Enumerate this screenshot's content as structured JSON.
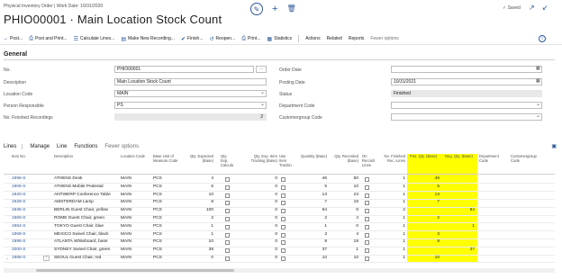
{
  "header": {
    "breadcrumb": "Physical Inventory Order | Work Date: 10/31/2020",
    "title": "PHIO00001 · Main Location Stock Count",
    "saved_label": "✓ Saved",
    "edit_icon": "pencil-icon",
    "new_icon": "plus-icon",
    "delete_icon": "trash-icon"
  },
  "actions": [
    {
      "icon": "post-icon",
      "label": "Post..."
    },
    {
      "icon": "post-print-icon",
      "label": "Post and Print..."
    },
    {
      "icon": "calculate-icon",
      "label": "Calculate Lines..."
    },
    {
      "icon": "recording-icon",
      "label": "Make New Recording..."
    },
    {
      "icon": "check-icon",
      "label": "Finish..."
    },
    {
      "icon": "reopen-icon",
      "label": "Reopen..."
    },
    {
      "icon": "print-icon",
      "label": "Print..."
    },
    {
      "icon": "statistics-icon",
      "label": "Statistics"
    }
  ],
  "action_menus": [
    "Actions",
    "Related",
    "Reports",
    "Fewer options"
  ],
  "general": {
    "section_title": "General",
    "left": [
      {
        "label": "No.",
        "value": "PHIO00001",
        "kind": "text"
      },
      {
        "label": "Description",
        "value": "Main Location Stock Count",
        "kind": "text"
      },
      {
        "label": "Location Code",
        "value": "MAIN",
        "kind": "select"
      },
      {
        "label": "Person Responsible",
        "value": "PS",
        "kind": "select"
      },
      {
        "label": "No. Finished Recordings",
        "value": "2",
        "kind": "readonly"
      }
    ],
    "right": [
      {
        "label": "Order Date",
        "value": "",
        "kind": "date"
      },
      {
        "label": "Posting Date",
        "value": "10/31/2021",
        "kind": "date"
      },
      {
        "label": "Status",
        "value": "Finished",
        "kind": "readonly"
      },
      {
        "label": "Department Code",
        "value": "",
        "kind": "select"
      },
      {
        "label": "Customergroup Code",
        "value": "",
        "kind": "select"
      }
    ]
  },
  "lines": {
    "tabs": [
      "Lines",
      "Manage",
      "Line",
      "Functions",
      "Fewer options"
    ],
    "columns": {
      "item_no": "Item No.",
      "description": "Description",
      "location": "Location Code",
      "base_uom": "Base Unit of Measure Code",
      "qty_expected": "Qty. Expected (Base)",
      "qty_exp_calculated": "Qty. Exp. Calculated",
      "qty_exp_item_tracking": "Qty. Exp. Item Tracking (Base)",
      "use_item_tracking": "Use Item Tracking",
      "quantity_base": "Quantity (Base)",
      "qty_recorded": "Qty. Recorded (Base)",
      "on_recording_lines": "On Recording Lines",
      "no_finished_rec_lines": "No. Finished Rec.-Lines",
      "pos_qty": "Pos. Qty. (Base)",
      "neg_qty": "Neg. Qty. (Base)",
      "department_code": "Department Code",
      "customergroup_code": "Customergroup Code"
    },
    "rows": [
      {
        "item": "1896-S",
        "desc": "ATHENS Desk",
        "loc": "MAIN",
        "uom": "PCS",
        "exp": "4",
        "expitem": "0",
        "qty": "46",
        "rec": "50",
        "fin": "1",
        "pos": "46",
        "neg": ""
      },
      {
        "item": "1906-S",
        "desc": "ATHENS Mobile Pedestal",
        "loc": "MAIN",
        "uom": "PCS",
        "exp": "5",
        "expitem": "0",
        "qty": "5",
        "rec": "10",
        "fin": "1",
        "pos": "5",
        "neg": ""
      },
      {
        "item": "1920-S",
        "desc": "ANTWERP Conference Table",
        "loc": "MAIN",
        "uom": "PCS",
        "exp": "10",
        "expitem": "0",
        "qty": "13",
        "rec": "23",
        "fin": "1",
        "pos": "13",
        "neg": ""
      },
      {
        "item": "1928-S",
        "desc": "AMSTERDAM Lamp",
        "loc": "MAIN",
        "uom": "PCS",
        "exp": "8",
        "expitem": "0",
        "qty": "7",
        "rec": "15",
        "fin": "1",
        "pos": "7",
        "neg": ""
      },
      {
        "item": "1936-S",
        "desc": "BERLIN Guest Chair, yellow",
        "loc": "MAIN",
        "uom": "PCS",
        "exp": "100",
        "expitem": "0",
        "qty": "94",
        "rec": "6",
        "fin": "2",
        "pos": "",
        "neg": "94"
      },
      {
        "item": "1960-S",
        "desc": "ROME Guest Chair, green",
        "loc": "MAIN",
        "uom": "PCS",
        "exp": "2",
        "expitem": "0",
        "qty": "2",
        "rec": "4",
        "fin": "1",
        "pos": "2",
        "neg": ""
      },
      {
        "item": "1964-S",
        "desc": "TOKYO Guest Chair, blue",
        "loc": "MAIN",
        "uom": "PCS",
        "exp": "1",
        "expitem": "0",
        "qty": "1",
        "rec": "0",
        "fin": "1",
        "pos": "",
        "neg": "1"
      },
      {
        "item": "1968-S",
        "desc": "MEXICO Swivel Chair, black",
        "loc": "MAIN",
        "uom": "PCS",
        "exp": "1",
        "expitem": "0",
        "qty": "3",
        "rec": "4",
        "fin": "1",
        "pos": "3",
        "neg": ""
      },
      {
        "item": "1996-S",
        "desc": "ATLANTA Whiteboard, base",
        "loc": "MAIN",
        "uom": "PCS",
        "exp": "10",
        "expitem": "0",
        "qty": "8",
        "rec": "18",
        "fin": "1",
        "pos": "8",
        "neg": ""
      },
      {
        "item": "2000-S",
        "desc": "SYDNEY Swivel Chair, green",
        "loc": "MAIN",
        "uom": "PCS",
        "exp": "38",
        "expitem": "0",
        "qty": "37",
        "rec": "1",
        "fin": "1",
        "pos": "",
        "neg": "37"
      },
      {
        "item": "1988-S",
        "desc": "SEOUL Guest Chair, red",
        "loc": "MAIN",
        "uom": "PCS",
        "exp": "0",
        "expitem": "0",
        "qty": "10",
        "rec": "10",
        "fin": "1",
        "pos": "10",
        "neg": ""
      }
    ],
    "highlight_color": "#ffff00"
  }
}
